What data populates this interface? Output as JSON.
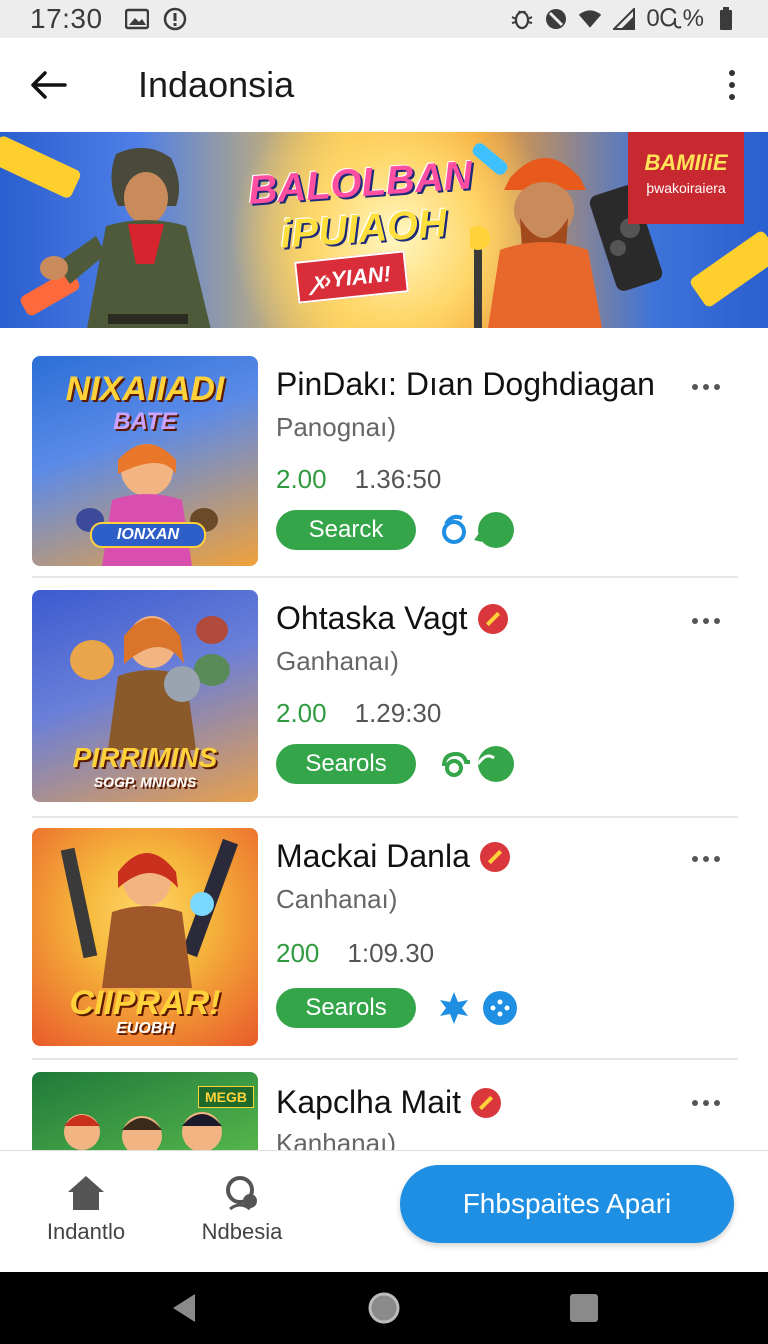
{
  "status_bar": {
    "time": "17:30",
    "battery_text": "0Ꮹ%",
    "icons": [
      "image-icon",
      "alert-circle-icon",
      "bug-icon",
      "do-not-disturb-icon",
      "wifi-icon",
      "signal-icon",
      "battery-icon"
    ]
  },
  "app_bar": {
    "title": "Indaonsia",
    "back_icon": "arrow-left-icon",
    "menu_icon": "more-vertical-icon"
  },
  "banner": {
    "headline_line1": "BALOLBAN",
    "headline_line2": "iPUIAOH",
    "ribbon": "ꭗ›YIAN!",
    "badge_title": "BAMIliE",
    "badge_sub": "þwakoiraiera"
  },
  "games": [
    {
      "title": "PinDakı: Dıan Doghdiagan",
      "subtitle": "Panognaı)",
      "rating": "2.00",
      "time": "1.36:50",
      "button": "Searck",
      "verified": false,
      "thumb_caption_top": "NIXAIIADI",
      "thumb_caption_mid": "BATE",
      "thumb_caption_bottom": "IONXAN",
      "thumb_bg": [
        "#2b6fd6",
        "#f0a23a"
      ],
      "icon_color": "#1e8fe2"
    },
    {
      "title": "Ohtaska Vagt",
      "subtitle": "Ganhanaı)",
      "rating": "2.00",
      "time": "1.29:30",
      "button": "Searols",
      "verified": true,
      "thumb_caption_top": "PIRRIMINS",
      "thumb_caption_bottom": "SOGP. MNIONS",
      "thumb_bg": [
        "#3b5bd0",
        "#e8a04c"
      ],
      "icon_color": "#35a54a"
    },
    {
      "title": "Mackai Danla",
      "subtitle": "Canhanaı)",
      "rating": "200",
      "time": "1:09.30",
      "button": "Searols",
      "verified": true,
      "thumb_caption_top": "CIIPRAR!",
      "thumb_caption_bottom": "EUOBH",
      "thumb_bg": [
        "#e85a2a",
        "#f6b83c"
      ],
      "icon_color": "#1e8fe2"
    },
    {
      "title": "Kapclha Mait",
      "subtitle": "Kanhanaı)",
      "rating": "",
      "time": "",
      "button": "",
      "verified": true,
      "thumb_caption_top": "MEGB",
      "thumb_caption_bottom": "",
      "thumb_bg": [
        "#1f7a3a",
        "#9fd04a"
      ],
      "icon_color": "#35a54a"
    }
  ],
  "bottom_nav": {
    "home_label": "Indantlo",
    "search_label": "Ndbesia",
    "fab_label": "Fhbspaites Apari"
  },
  "colors": {
    "accent_blue": "#1e8fe2",
    "accent_green": "#35a54a",
    "rating_green": "#2f9a3e",
    "verified_red": "#d9373b"
  }
}
